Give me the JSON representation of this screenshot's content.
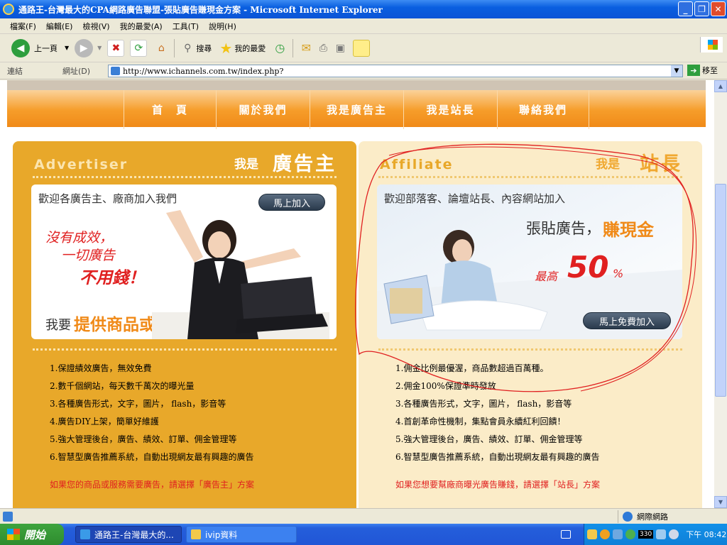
{
  "window": {
    "title": "通路王-台灣最大的CPA網路廣告聯盟-張貼廣告賺現金方案 - Microsoft Internet Explorer",
    "min": "_",
    "max": "❐",
    "close": "✕"
  },
  "menu": [
    "檔案(F)",
    "編輯(E)",
    "檢視(V)",
    "我的最愛(A)",
    "工具(T)",
    "說明(H)"
  ],
  "toolbar": {
    "back": "上一頁",
    "search": "搜尋",
    "favorites": "我的最愛"
  },
  "addressbar": {
    "links": "連結",
    "label": "網址(D)",
    "url": "http://www.ichannels.com.tw/index.php?",
    "go": "移至"
  },
  "nav": [
    "首　頁",
    "關於我們",
    "我是廣告主",
    "我是站長",
    "聯絡我們"
  ],
  "advertiser": {
    "title_en": "Advertiser",
    "title_me": "我是",
    "title_big": "廣告主",
    "card_head": "歡迎各廣告主、廠商加入我們",
    "join": "馬上加入",
    "slogan1": "沒有成效，",
    "slogan2": "一切廣告",
    "slogan3": "不用錢！",
    "offer_prefix": "我要",
    "offer": "提供商品或服務",
    "list": [
      "1.保證績效廣告，無效免費",
      "2.數千個網站，每天數千萬次的曝光量",
      "3.各種廣告形式，文字，圖片， flash，影音等",
      "4.廣告DIY上架，簡單好維護",
      "5.強大管理後台，廣告、績效、訂單、佣金管理等",
      "6.智慧型廣告推薦系統，自動出現網友最有興趣的廣告"
    ],
    "note": "如果您的商品或服務需要廣告，請選擇「廣告主」方案"
  },
  "affiliate": {
    "title_en": "Affiliate",
    "title_me": "我是",
    "title_big": "站長",
    "card_head": "歡迎部落客、論壇站長、內容網站加入",
    "tag1": "張貼廣告，",
    "tag2": "賺現金",
    "max_label": "最高",
    "max_value": "50",
    "max_unit": "%",
    "join": "馬上免費加入",
    "list": [
      "1.佣金比例最優渥，商品數超過百萬種。",
      "2.佣金100%保證準時發放",
      "3.各種廣告形式，文字，圖片， flash，影音等",
      "4.首創革命性機制，集點會員永續紅利回饋！",
      "5.強大管理後台，廣告、績效、訂單、佣金管理等",
      "6.智慧型廣告推薦系統，自動出現網友最有興趣的廣告"
    ],
    "note": "如果您想要幫廠商曝光廣告賺錢，請選擇「站長」方案"
  },
  "status": {
    "zone": "網際網路"
  },
  "taskbar": {
    "start": "開始",
    "task1": "通路王-台灣最大的...",
    "task2": "ivip資料",
    "tray_num": "330",
    "clock": "下午 08:42"
  }
}
